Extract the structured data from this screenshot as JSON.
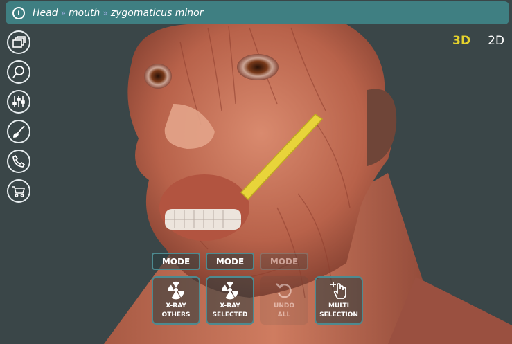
{
  "breadcrumb": {
    "items": [
      "Head",
      "mouth",
      "zygomaticus minor"
    ],
    "separator": "»",
    "info_icon": "info-icon"
  },
  "sidebar": {
    "items": [
      {
        "name": "folder-gallery-icon"
      },
      {
        "name": "search-icon"
      },
      {
        "name": "sliders-icon"
      },
      {
        "name": "brush-icon"
      },
      {
        "name": "phone-icon"
      },
      {
        "name": "cart-icon"
      }
    ]
  },
  "view_toggle": {
    "option_3d": "3D",
    "option_2d": "2D",
    "active": "3D",
    "active_color": "#e5d22c"
  },
  "controls": {
    "mode_labels": [
      "MODE",
      "MODE",
      "MODE"
    ],
    "xray_others": {
      "line1": "X-RAY",
      "line2": "OTHERS",
      "icon": "radiation-icon"
    },
    "xray_selected": {
      "line1": "X-RAY",
      "line2": "SELECTED",
      "icon": "radiation-icon"
    },
    "undo_all": {
      "line1": "UNDO",
      "line2": "ALL",
      "icon": "undo-icon"
    },
    "multi_selection": {
      "line1": "MULTI",
      "line2": "SELECTION",
      "icon": "hand-plus-icon"
    }
  },
  "colors": {
    "accent": "#3f7f82",
    "highlight_muscle": "#e8d43a",
    "background": "#3a4648"
  }
}
